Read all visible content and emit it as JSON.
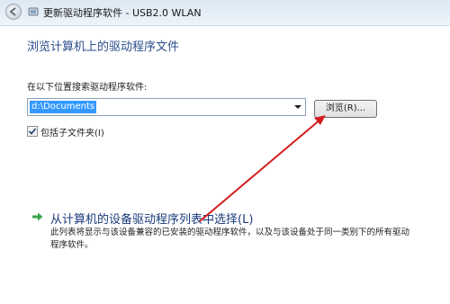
{
  "window": {
    "title": "更新驱动程序软件 - USB2.0 WLAN",
    "back_icon": "back-arrow-icon",
    "title_icon": "device-icon"
  },
  "main": {
    "heading": "浏览计算机上的驱动程序文件",
    "search_label": "在以下位置搜索驱动程序软件:",
    "path_value": "d:\\Documents",
    "browse_label": "浏览(R)...",
    "include_subfolders_label": "包括子文件夹(I)",
    "include_subfolders_checked": true
  },
  "pick_option": {
    "title": "从计算机的设备驱动程序列表中选择(L)",
    "description": "此列表将显示与该设备兼容的已安装的驱动程序软件，以及与该设备处于同一类别下的所有驱动程序软件。",
    "icon": "green-arrow-icon"
  },
  "annotation": {
    "color": "#d21e1e",
    "icon": "red-annotation-arrow"
  }
}
